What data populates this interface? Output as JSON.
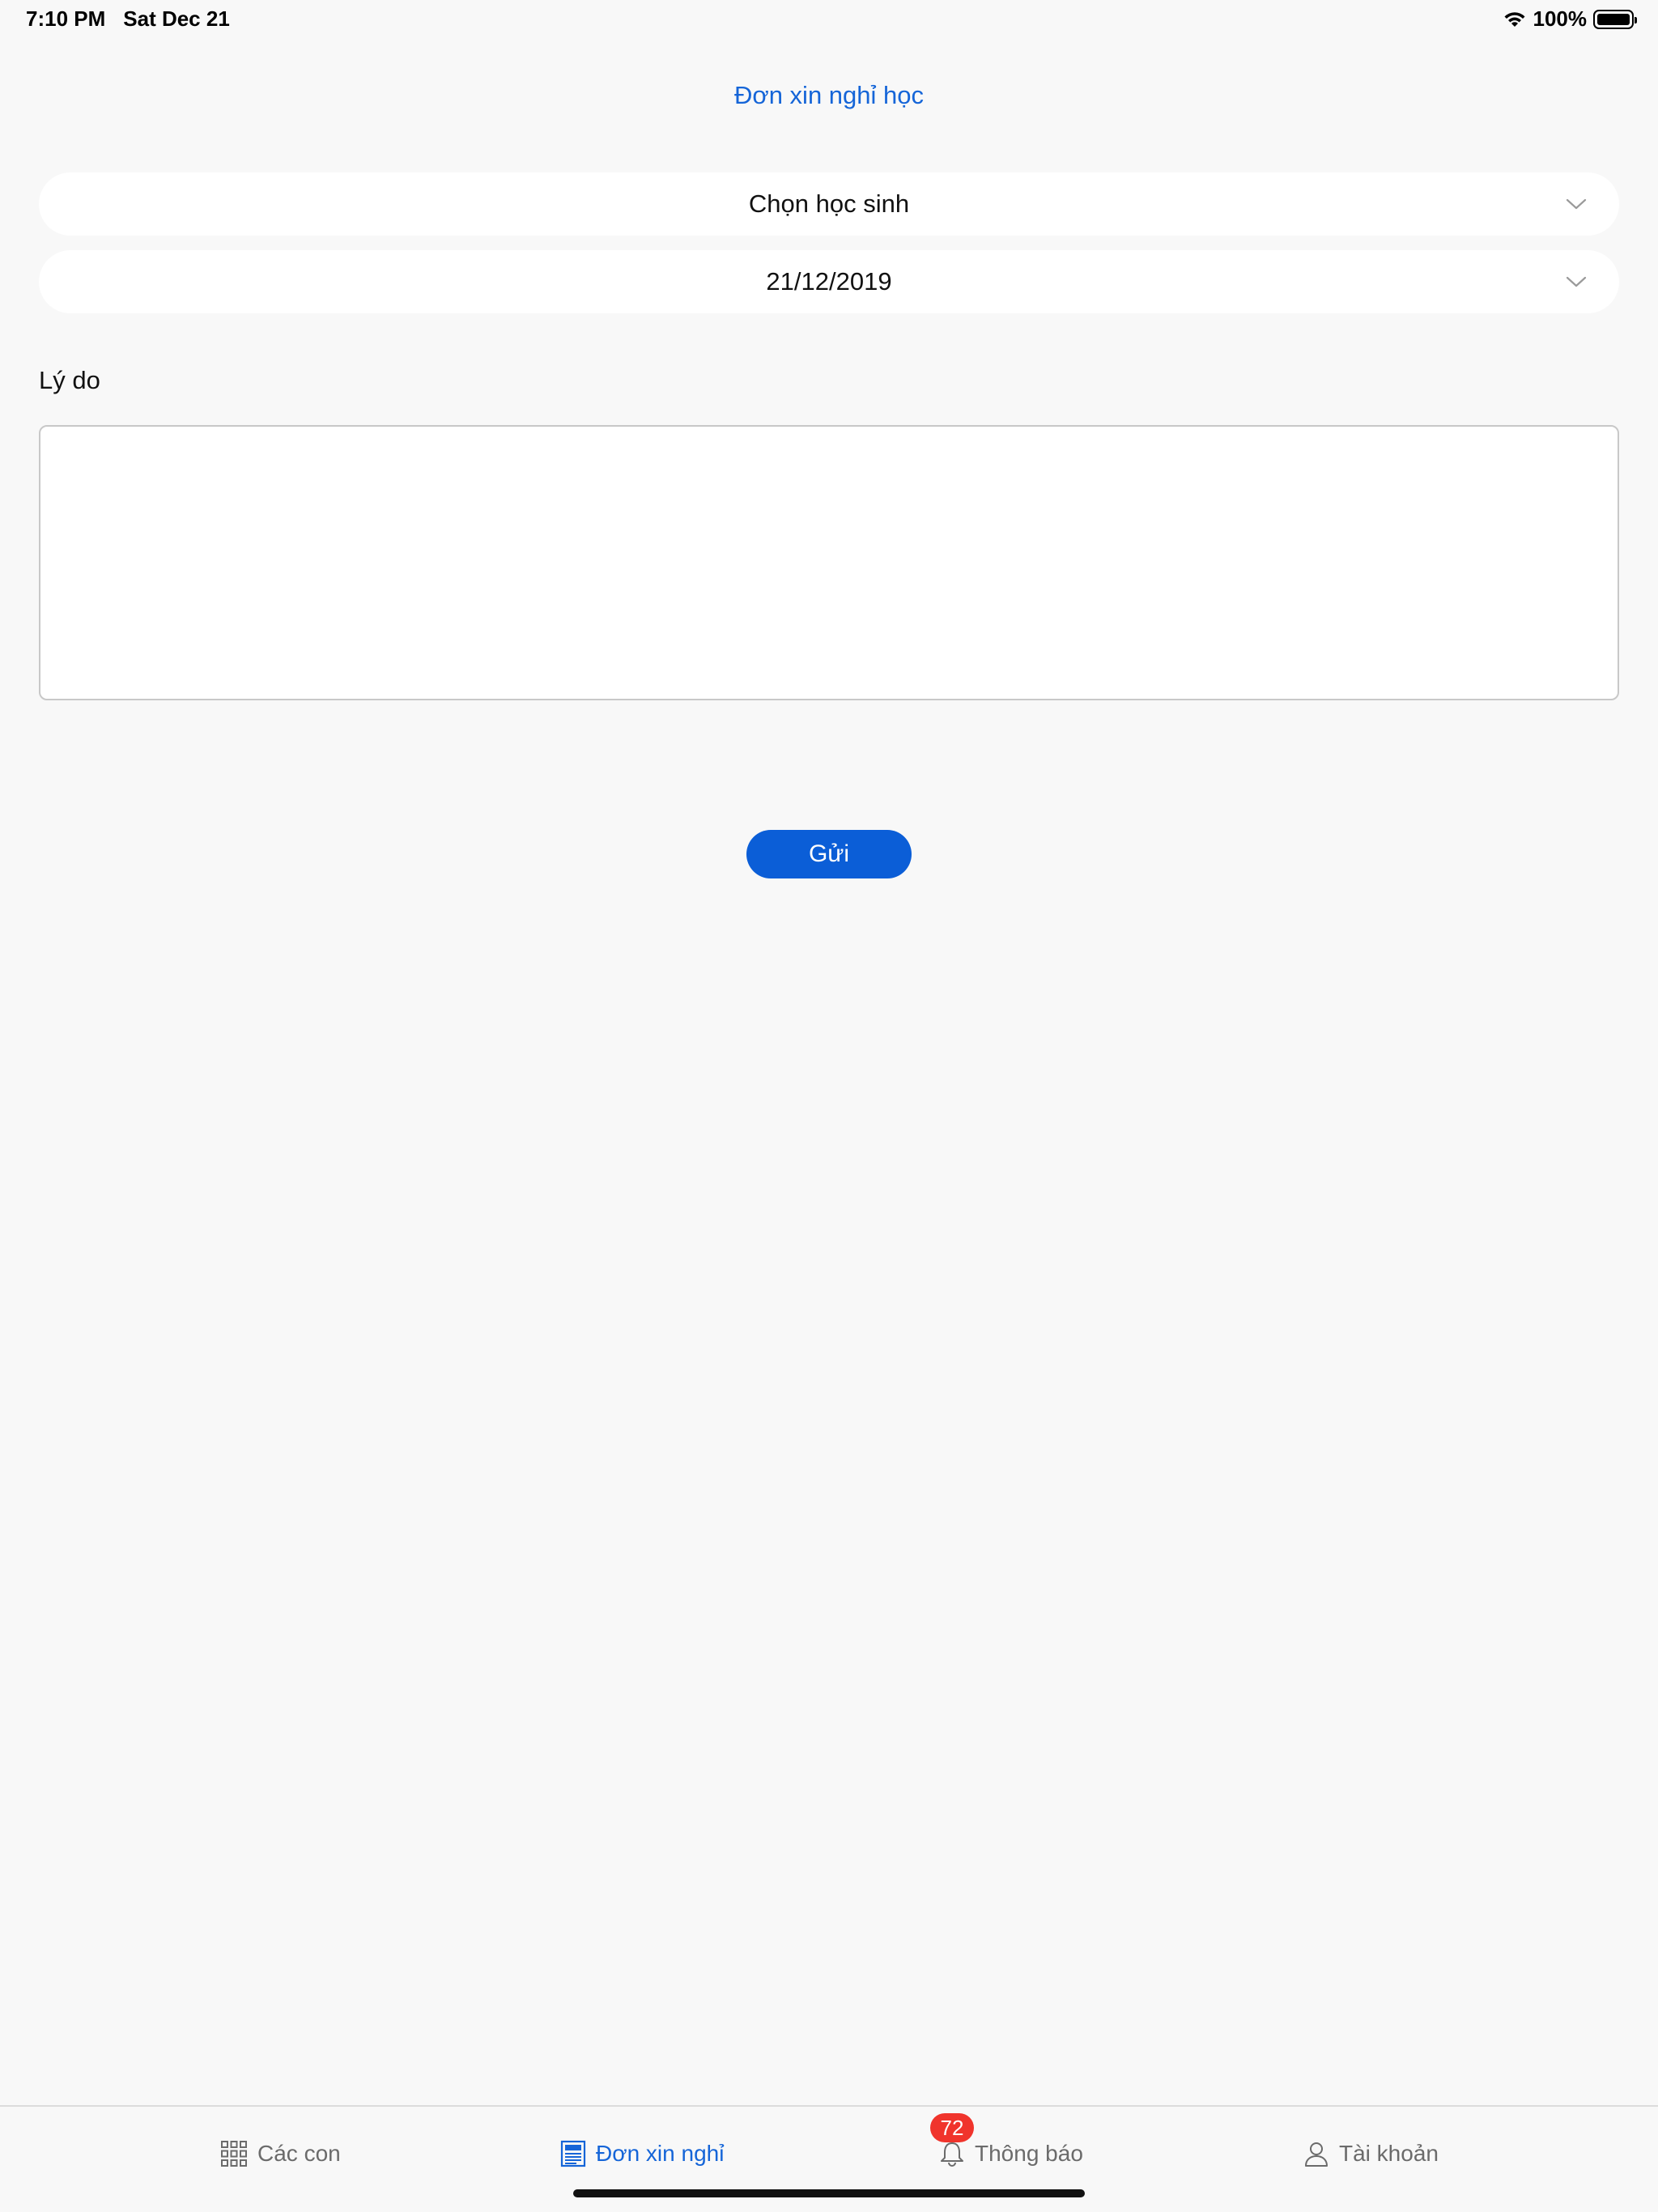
{
  "status_bar": {
    "time": "7:10 PM",
    "date": "Sat Dec 21",
    "battery": "100%"
  },
  "header": {
    "title": "Đơn xin nghỉ học"
  },
  "form": {
    "student_select": {
      "value": "Chọn học sinh"
    },
    "date_select": {
      "value": "21/12/2019"
    },
    "reason_label": "Lý do",
    "reason_value": "",
    "submit_label": "Gửi"
  },
  "tabs": [
    {
      "label": "Các con",
      "icon": "grid-icon",
      "active": false
    },
    {
      "label": "Đơn xin nghỉ",
      "icon": "document-icon",
      "active": true
    },
    {
      "label": "Thông báo",
      "icon": "bell-icon",
      "active": false,
      "badge": "72"
    },
    {
      "label": "Tài khoản",
      "icon": "person-icon",
      "active": false
    }
  ],
  "colors": {
    "accent": "#1565d8",
    "button": "#0b5ed7",
    "badge": "#f0342c",
    "background": "#f8f8f8"
  }
}
